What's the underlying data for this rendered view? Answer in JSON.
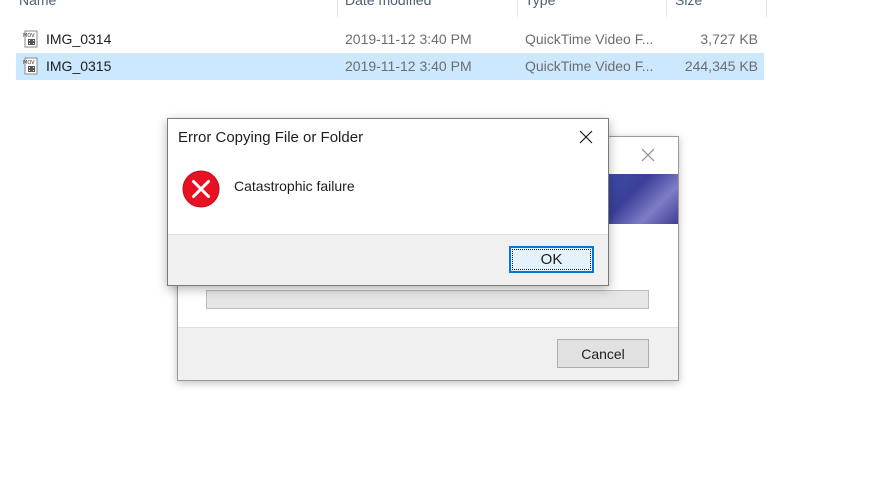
{
  "explorer": {
    "columns": {
      "name": "Name",
      "date_modified": "Date modified",
      "type": "Type",
      "size": "Size"
    },
    "files": [
      {
        "name": "IMG_0314",
        "date": "2019-11-12 3:40 PM",
        "type": "QuickTime Video F...",
        "size": "3,727 KB",
        "icon": "mov-file-icon",
        "selected": false
      },
      {
        "name": "IMG_0315",
        "date": "2019-11-12 3:40 PM",
        "type": "QuickTime Video F...",
        "size": "244,345 KB",
        "icon": "mov-file-icon",
        "selected": true
      }
    ],
    "selection_color": "#cce8ff"
  },
  "progress_dialog": {
    "cancel_label": "Cancel",
    "progress_fraction": 0,
    "close_icon": "close-icon"
  },
  "error_dialog": {
    "title": "Error Copying File or Folder",
    "message": "Catastrophic failure",
    "ok_label": "OK",
    "icon": "error-icon",
    "error_color": "#e81123",
    "accent_color": "#0078d7"
  }
}
